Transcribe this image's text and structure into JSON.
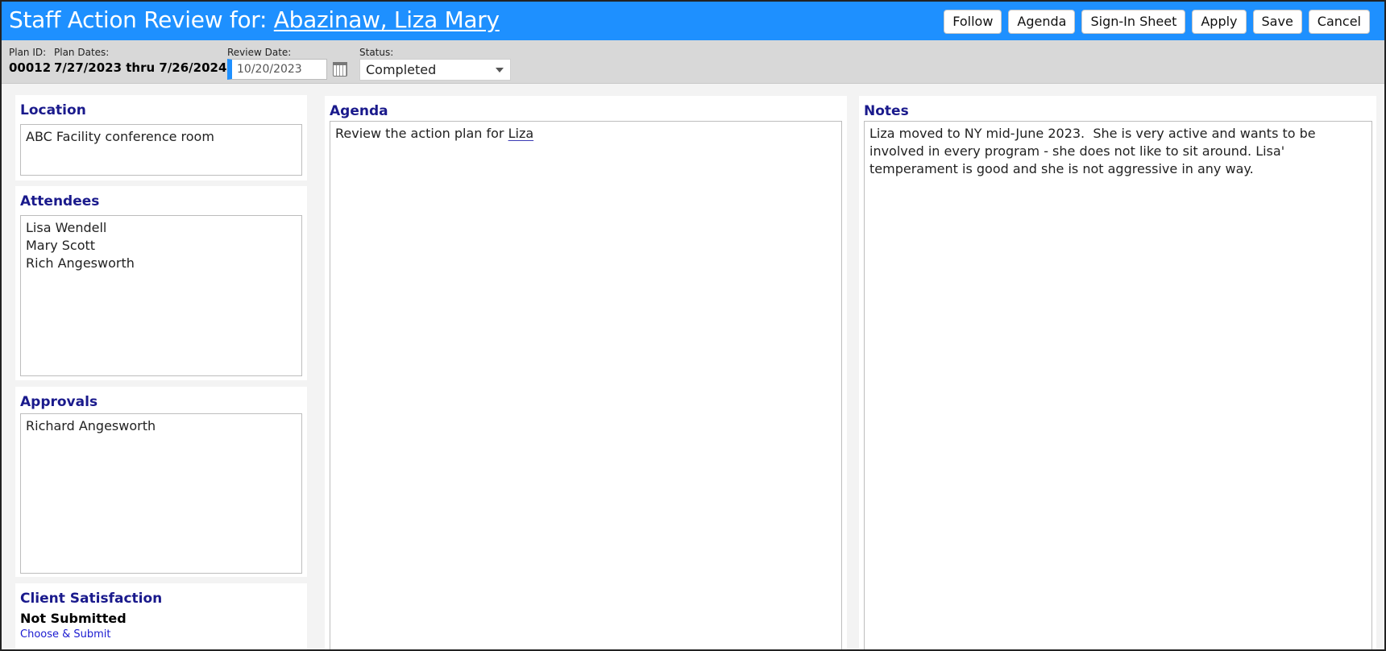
{
  "header": {
    "title_prefix": "Staff Action Review for: ",
    "client_name": "Abazinaw, Liza Mary",
    "buttons": {
      "follow": "Follow",
      "agenda": "Agenda",
      "sign_in_sheet": "Sign-In Sheet",
      "apply": "Apply",
      "save": "Save",
      "cancel": "Cancel"
    }
  },
  "plan": {
    "id_label": "Plan ID:",
    "id_value": "00012",
    "dates_label": "Plan Dates:",
    "dates_value": "7/27/2023 thru 7/26/2024",
    "review_date_label": "Review Date:",
    "review_date_value": "10/20/2023",
    "status_label": "Status:",
    "status_value": "Completed"
  },
  "location": {
    "title": "Location",
    "value": "ABC Facility conference room"
  },
  "attendees": {
    "title": "Attendees",
    "items": [
      "Lisa Wendell",
      "Mary Scott",
      "Rich Angesworth"
    ]
  },
  "approvals": {
    "title": "Approvals",
    "items": [
      "Richard Angesworth"
    ]
  },
  "client_satisfaction": {
    "title": "Client Satisfaction",
    "status": "Not Submitted",
    "link": "Choose & Submit"
  },
  "agenda": {
    "title": "Agenda",
    "text_prefix": "Review the action plan for ",
    "text_name": "Liza"
  },
  "notes": {
    "title": "Notes",
    "text": "Liza moved to NY mid-June 2023.  She is very active and wants to be involved in every program - she does not like to sit around. Lisa' temperament is good and she is not aggressive in any way."
  },
  "colors": {
    "header_bg": "#1e90ff",
    "section_title": "#1a1a8c",
    "link": "#1a1ad0"
  }
}
